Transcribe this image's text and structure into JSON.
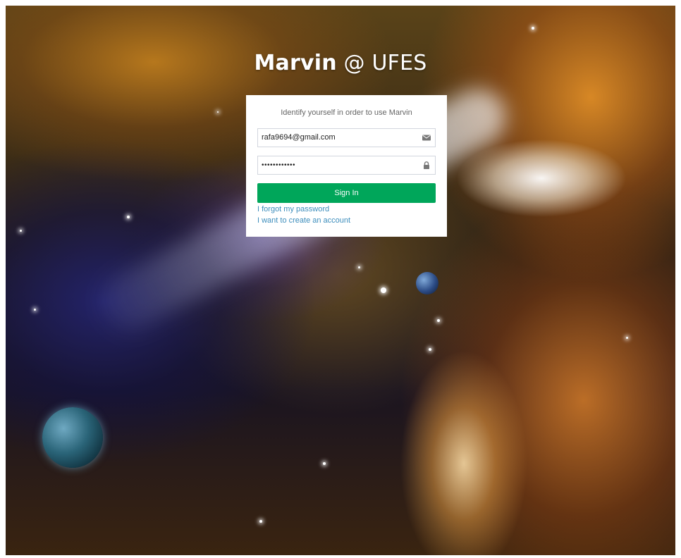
{
  "header": {
    "brand": "Marvin",
    "suffix": " @ UFES"
  },
  "login": {
    "subtitle": "Identify yourself in order to use Marvin",
    "email_value": "rafa9694@gmail.com",
    "password_value": "••••••••••••",
    "email_icon": "envelope-icon",
    "password_icon": "lock-icon",
    "signin_label": "Sign In",
    "forgot_label": "I forgot my password",
    "create_label": "I want to create an account"
  },
  "colors": {
    "signin_button": "#00a65a",
    "link": "#3c8dbc"
  }
}
